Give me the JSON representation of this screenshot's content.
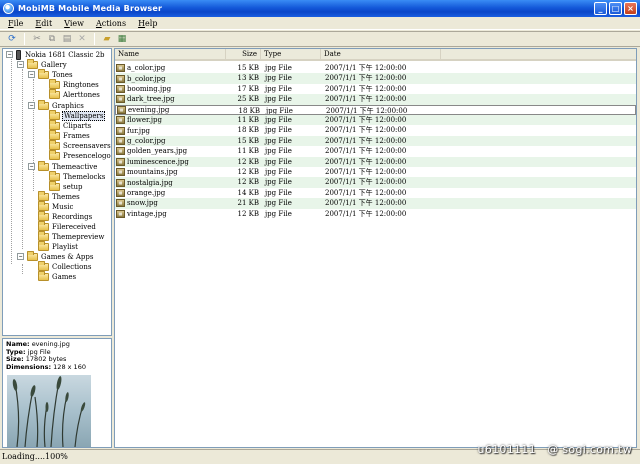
{
  "window": {
    "title": "MobiMB Mobile Media Browser"
  },
  "menu": [
    {
      "u": "F",
      "rest": "ile"
    },
    {
      "u": "E",
      "rest": "dit"
    },
    {
      "u": "V",
      "rest": "iew"
    },
    {
      "u": "A",
      "rest": "ctions"
    },
    {
      "u": "H",
      "rest": "elp"
    }
  ],
  "toolbar": {
    "icons": [
      "refresh-icon",
      "cut-icon",
      "copy-icon",
      "paste-icon",
      "delete-icon",
      "open-folder-icon",
      "properties-icon"
    ]
  },
  "tree": {
    "root": "Nokia 1681 Classic 2b",
    "gallery": "Gallery",
    "tones": "Tones",
    "ringtones": "Ringtones",
    "alerttones": "Alerttones",
    "graphics": "Graphics",
    "wallpapers": "Wallpapers",
    "cliparts": "Cliparts",
    "frames": "Frames",
    "screensavers": "Screensavers",
    "presencelogo": "Presencelogo",
    "themeactive": "Themeactive",
    "themelocks": "Themelocks",
    "setup": "setup",
    "themes": "Themes",
    "music": "Music",
    "recordings": "Recordings",
    "filereceived": "Filereceived",
    "themepreview": "Themepreview",
    "playlist": "Playlist",
    "games_apps": "Games & Apps",
    "collections": "Collections",
    "games": "Games"
  },
  "info": {
    "name_label": "Name:",
    "name": "evening.jpg",
    "type_label": "Type:",
    "type": "jpg File",
    "size_label": "Size:",
    "size": "17802 bytes",
    "dim_label": "Dimensions:",
    "dim": "128 x 160"
  },
  "list": {
    "columns": {
      "name": "Name",
      "size": "Size",
      "type": "Type",
      "date": "Date"
    },
    "rows": [
      {
        "name": "a_color.jpg",
        "size": "15 KB",
        "type": "jpg File",
        "date": "2007/1/1 下午 12:00:00"
      },
      {
        "name": "b_color.jpg",
        "size": "13 KB",
        "type": "jpg File",
        "date": "2007/1/1 下午 12:00:00"
      },
      {
        "name": "booming.jpg",
        "size": "17 KB",
        "type": "jpg File",
        "date": "2007/1/1 下午 12:00:00"
      },
      {
        "name": "dark_tree.jpg",
        "size": "25 KB",
        "type": "jpg File",
        "date": "2007/1/1 下午 12:00:00"
      },
      {
        "name": "evening.jpg",
        "size": "18 KB",
        "type": "jpg File",
        "date": "2007/1/1 下午 12:00:00"
      },
      {
        "name": "flower.jpg",
        "size": "11 KB",
        "type": "jpg File",
        "date": "2007/1/1 下午 12:00:00"
      },
      {
        "name": "fur.jpg",
        "size": "18 KB",
        "type": "jpg File",
        "date": "2007/1/1 下午 12:00:00"
      },
      {
        "name": "g_color.jpg",
        "size": "15 KB",
        "type": "jpg File",
        "date": "2007/1/1 下午 12:00:00"
      },
      {
        "name": "golden_years.jpg",
        "size": "11 KB",
        "type": "jpg File",
        "date": "2007/1/1 下午 12:00:00"
      },
      {
        "name": "luminescence.jpg",
        "size": "12 KB",
        "type": "jpg File",
        "date": "2007/1/1 下午 12:00:00"
      },
      {
        "name": "mountains.jpg",
        "size": "12 KB",
        "type": "jpg File",
        "date": "2007/1/1 下午 12:00:00"
      },
      {
        "name": "nostalgia.jpg",
        "size": "12 KB",
        "type": "jpg File",
        "date": "2007/1/1 下午 12:00:00"
      },
      {
        "name": "orange.jpg",
        "size": "14 KB",
        "type": "jpg File",
        "date": "2007/1/1 下午 12:00:00"
      },
      {
        "name": "snow.jpg",
        "size": "21 KB",
        "type": "jpg File",
        "date": "2007/1/1 下午 12:00:00"
      },
      {
        "name": "vintage.jpg",
        "size": "12 KB",
        "type": "jpg File",
        "date": "2007/1/1 下午 12:00:00"
      }
    ]
  },
  "status": {
    "text": "Loading....100%"
  },
  "watermark": "u6101111   @ sogi.com.tw"
}
